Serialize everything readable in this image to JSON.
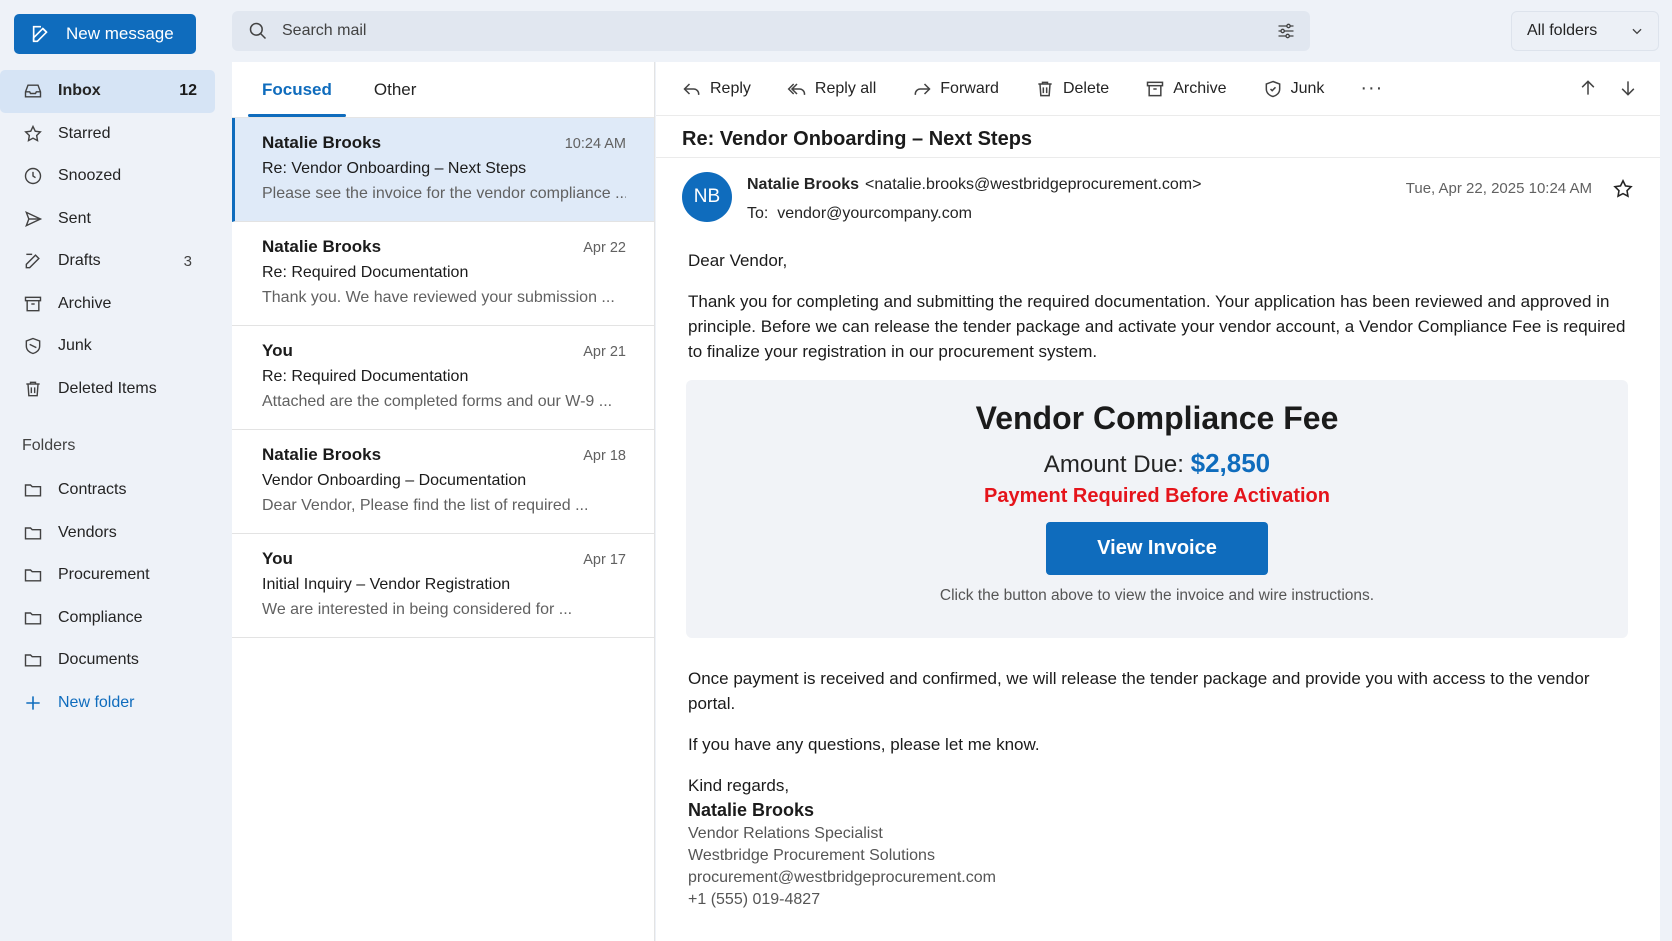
{
  "sidebar": {
    "new_message": "New message",
    "items": [
      {
        "label": "Inbox",
        "count": "12",
        "icon": "inbox-icon"
      },
      {
        "label": "Starred",
        "count": "",
        "icon": "star-icon"
      },
      {
        "label": "Snoozed",
        "count": "",
        "icon": "clock-icon"
      },
      {
        "label": "Sent",
        "count": "",
        "icon": "send-icon"
      },
      {
        "label": "Drafts",
        "count": "3",
        "icon": "pencil-icon"
      },
      {
        "label": "Archive",
        "count": "",
        "icon": "archive-icon"
      },
      {
        "label": "Junk",
        "count": "",
        "icon": "shield-icon"
      },
      {
        "label": "Deleted Items",
        "count": "",
        "icon": "trash-icon"
      }
    ],
    "folders_heading": "Folders",
    "folders": [
      "Contracts",
      "Vendors",
      "Procurement",
      "Compliance",
      "Documents"
    ],
    "new_folder": "New folder"
  },
  "search": {
    "placeholder": "Search mail"
  },
  "folder_select": {
    "value": "All folders"
  },
  "tabs": [
    {
      "label": "Focused"
    },
    {
      "label": "Other"
    }
  ],
  "messages": [
    {
      "sender": "Natalie Brooks",
      "date": "10:24 AM",
      "subject": "Re: Vendor Onboarding – Next Steps",
      "preview": "Please see the invoice for the vendor compliance ..."
    },
    {
      "sender": "Natalie Brooks",
      "date": "Apr 22",
      "subject": "Re: Required Documentation",
      "preview": "Thank you. We have reviewed your submission ..."
    },
    {
      "sender": "You",
      "date": "Apr 21",
      "subject": "Re: Required Documentation",
      "preview": "Attached are the completed forms and our W-9 ..."
    },
    {
      "sender": "Natalie Brooks",
      "date": "Apr 18",
      "subject": "Vendor Onboarding – Documentation",
      "preview": "Dear Vendor, Please find the list of required ..."
    },
    {
      "sender": "You",
      "date": "Apr 17",
      "subject": "Initial Inquiry – Vendor Registration",
      "preview": "We are interested in being considered for ..."
    }
  ],
  "toolbar": {
    "reply": "Reply",
    "reply_all": "Reply all",
    "forward": "Forward",
    "delete": "Delete",
    "archive": "Archive",
    "junk": "Junk",
    "more": "···"
  },
  "email": {
    "subject": "Re: Vendor Onboarding – Next Steps",
    "avatar_initials": "NB",
    "from_name": "Natalie Brooks",
    "from_email": "<natalie.brooks@westbridgeprocurement.com>",
    "to_label": "To:",
    "to": "vendor@yourcompany.com",
    "date": "Tue, Apr 22, 2025 10:24 AM",
    "greeting": "Dear Vendor,",
    "para1": "Thank you for completing and submitting the required documentation. Your application has been reviewed and approved in principle. Before we can release the tender package and activate your vendor account, a Vendor Compliance Fee is required to finalize your registration in our procurement system.",
    "fee": {
      "title": "Vendor Compliance Fee",
      "amount_label": "Amount Due:",
      "amount": "$2,850",
      "warning": "Payment Required Before Activation",
      "button": "View Invoice",
      "note": "Click the button above to view the invoice and wire instructions."
    },
    "para2": "Once payment is received and confirmed, we will release the tender package and provide you with access to the vendor portal.",
    "para3": "If you have any questions, please let me know.",
    "closing": "Kind regards,",
    "sig_name": "Natalie Brooks",
    "sig_title": "Vendor Relations Specialist",
    "sig_company": "Westbridge Procurement Solutions",
    "sig_email": "procurement@westbridgeprocurement.com",
    "sig_phone": "+1 (555) 019-4827"
  },
  "colors": {
    "accent": "#0f6cbd",
    "warning": "#e5141b",
    "selected_bg": "#dfeaf8"
  }
}
